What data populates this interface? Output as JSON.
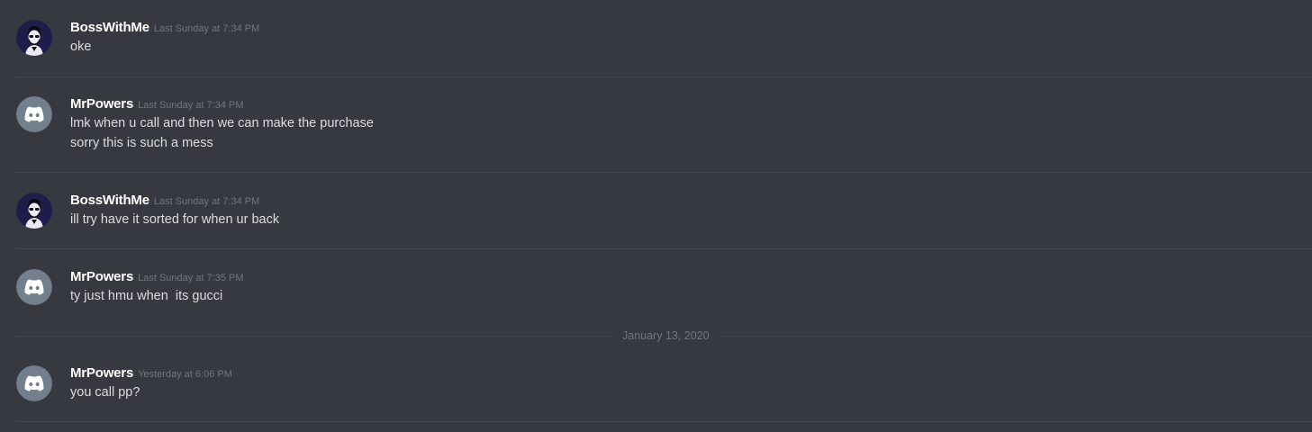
{
  "messages": [
    {
      "username": "BossWithMe",
      "timestamp": "Last Sunday at 7:34 PM",
      "avatar": "boss-avatar-icon",
      "lines": [
        "oke"
      ]
    },
    {
      "username": "MrPowers",
      "timestamp": "Last Sunday at 7:34 PM",
      "avatar": "discord-logo-icon",
      "lines": [
        "lmk when u call and then we can make the purchase",
        "sorry this is such a mess"
      ]
    },
    {
      "username": "BossWithMe",
      "timestamp": "Last Sunday at 7:34 PM",
      "avatar": "boss-avatar-icon",
      "lines": [
        "ill try have it sorted for when ur back"
      ]
    },
    {
      "username": "MrPowers",
      "timestamp": "Last Sunday at 7:35 PM",
      "avatar": "discord-logo-icon",
      "lines": [
        "ty just hmu when  its gucci"
      ]
    },
    {
      "username": "MrPowers",
      "timestamp": "Yesterday at 6:06 PM",
      "avatar": "discord-logo-icon",
      "lines": [
        "you call pp?"
      ]
    }
  ],
  "date_divider": "January 13, 2020",
  "colors": {
    "background": "#36393f",
    "username": "#ffffff",
    "message_text": "#dcddde",
    "timestamp": "#72767d",
    "divider": "#42454a",
    "default_avatar": "#747f8d",
    "boss_avatar_bg": "#1e1d4a"
  }
}
